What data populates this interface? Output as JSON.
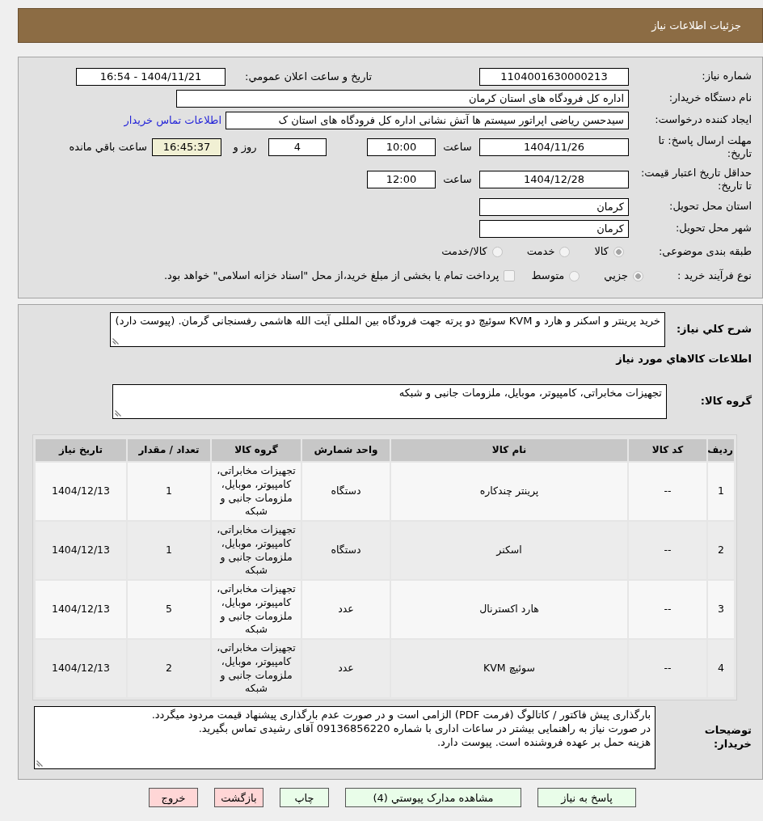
{
  "header": {
    "title": "جزئیات اطلاعات نیاز"
  },
  "details": {
    "need_number": {
      "label": "شماره نیاز:",
      "value": "1104001630000213"
    },
    "announce": {
      "label": "تاريخ و ساعت اعلان عمومي:",
      "value": "1404/11/21 - 16:54"
    },
    "buyer_org": {
      "label": "نام دستگاه خریدار:",
      "value": "اداره کل فرودگاه های استان کرمان"
    },
    "requester": {
      "label": "ایجاد کننده درخواست:",
      "value": "سیدحسن ریاضی اپراتور سیستم ها آتش نشانی اداره کل فرودگاه های استان ک",
      "link": "اطلاعات تماس خریدار"
    },
    "deadline": {
      "label": "مهلت ارسال پاسخ: تا تاریخ:",
      "date": "1404/11/26",
      "time_label": "ساعت",
      "time": "10:00",
      "days": "4",
      "days_label": "روز و",
      "remaining": "16:45:37",
      "remaining_label": "ساعت باقي مانده"
    },
    "price_validity": {
      "label": "حداقل تاریخ اعتبار قیمت: تا تاریخ:",
      "date": "1404/12/28",
      "time_label": "ساعت",
      "time": "12:00"
    },
    "province": {
      "label": "استان محل تحویل:",
      "value": "کرمان"
    },
    "city": {
      "label": "شهر محل تحویل:",
      "value": "کرمان"
    },
    "category": {
      "label": "طبقه بندی موضوعی:",
      "options": [
        {
          "label": "کالا",
          "selected": true,
          "disabled": true
        },
        {
          "label": "خدمت",
          "selected": false,
          "disabled": true
        },
        {
          "label": "کالا/خدمت",
          "selected": false,
          "disabled": true
        }
      ]
    },
    "process": {
      "label": "نوع فرآیند خرید :",
      "options": [
        {
          "label": "جزيي",
          "selected": true,
          "disabled": true
        },
        {
          "label": "متوسط",
          "selected": false,
          "disabled": true
        }
      ],
      "treasury": {
        "label": "پرداخت تمام یا بخشی از مبلغ خرید،از محل \"اسناد خزانه اسلامی\" خواهد بود.",
        "checked": false,
        "disabled": true
      }
    }
  },
  "description": {
    "label": "شرح کلي نیاز:",
    "value": "خرید پرینتر و اسکنر و هارد و KVM سوئیچ دو پرته جهت فرودگاه بین المللی آیت الله هاشمی رفسنجانی گرمان. (پیوست دارد)"
  },
  "goods": {
    "title": "اطلاعات کالاهاي مورد نیاز",
    "group_label": "گروه کالا:",
    "group_value": "تجهیزات مخابراتی، کامپیوتر، موبایل، ملزومات جانبی و شبکه",
    "table": {
      "columns": [
        "ردیف",
        "کد کالا",
        "نام کالا",
        "واحد شمارش",
        "گروه کالا",
        "تعداد / مقدار",
        "تاریخ نیاز"
      ],
      "rows": [
        [
          "1",
          "--",
          "پرینتر چندکاره",
          "دستگاه",
          "تجهیزات مخابراتی، کامپیوتر، موبایل، ملزومات جانبی و شبکه",
          "1",
          "1404/12/13"
        ],
        [
          "2",
          "--",
          "اسکنر",
          "دستگاه",
          "تجهیزات مخابراتی، کامپیوتر، موبایل، ملزومات جانبی و شبکه",
          "1",
          "1404/12/13"
        ],
        [
          "3",
          "--",
          "هارد اکسترنال",
          "عدد",
          "تجهیزات مخابراتی، کامپیوتر، موبایل، ملزومات جانبی و شبکه",
          "5",
          "1404/12/13"
        ],
        [
          "4",
          "--",
          "سوئیچ KVM",
          "عدد",
          "تجهیزات مخابراتی، کامپیوتر، موبایل، ملزومات جانبی و شبکه",
          "2",
          "1404/12/13"
        ]
      ]
    }
  },
  "buyer_notes": {
    "label": "توضیحات خریدار:",
    "value": "بارگذاری پیش فاکتور / کاتالوگ (فرمت PDF) الزامی است و در صورت عدم بارگذاری پیشنهاد قیمت مردود میگردد.\nدر صورت نیاز به راهنمایی بیشتر در ساعات اداری با شماره 09136856220 آقای رشیدی  تماس بگیرید.\nهزینه حمل بر عهده فروشنده است. پیوست دارد."
  },
  "buttons": [
    {
      "label": "پاسخ به نیاز",
      "kind": "action"
    },
    {
      "label": "مشاهده مدارک پیوستي (4)",
      "kind": "action"
    },
    {
      "label": "چاپ",
      "kind": "action"
    },
    {
      "label": "بازگشت",
      "kind": "navigation"
    },
    {
      "label": "خروج",
      "kind": "navigation"
    }
  ]
}
